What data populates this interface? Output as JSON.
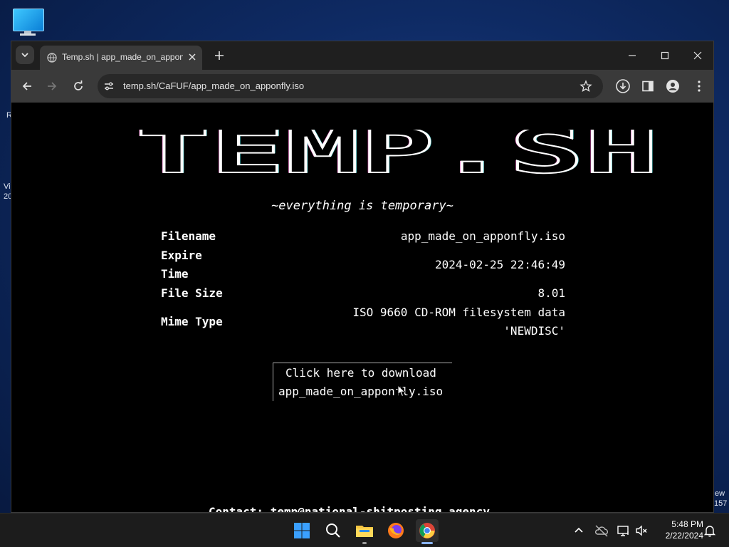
{
  "desktop": {
    "edge_texts": [
      "R",
      "Vi",
      "20",
      "ew",
      "157"
    ]
  },
  "browser": {
    "tab": {
      "title": "Temp.sh | app_made_on_apponfly.iso"
    },
    "url": "temp.sh/CaFUF/app_made_on_apponfly.iso"
  },
  "page": {
    "logo_text": "TEMP.SH",
    "tagline": "~everything is temporary~",
    "info": {
      "filename_label": "Filename",
      "filename_value": "app_made_on_apponfly.iso",
      "expire_label_1": "Expire",
      "expire_label_2": "Time",
      "expire_value": "2024-02-25 22:46:49",
      "size_label": "File Size",
      "size_value": "8.01",
      "mime_label": "Mime Type",
      "mime_value_1": "ISO 9660 CD-ROM filesystem data",
      "mime_value_2": "'NEWDISC'"
    },
    "download": {
      "line1": "Click here to download",
      "line2": "app_made_on_apponfly.iso"
    },
    "contact": "Contact: temp@national-shitposting.agency"
  },
  "taskbar": {
    "time": "5:48 PM",
    "date": "2/22/2024"
  }
}
